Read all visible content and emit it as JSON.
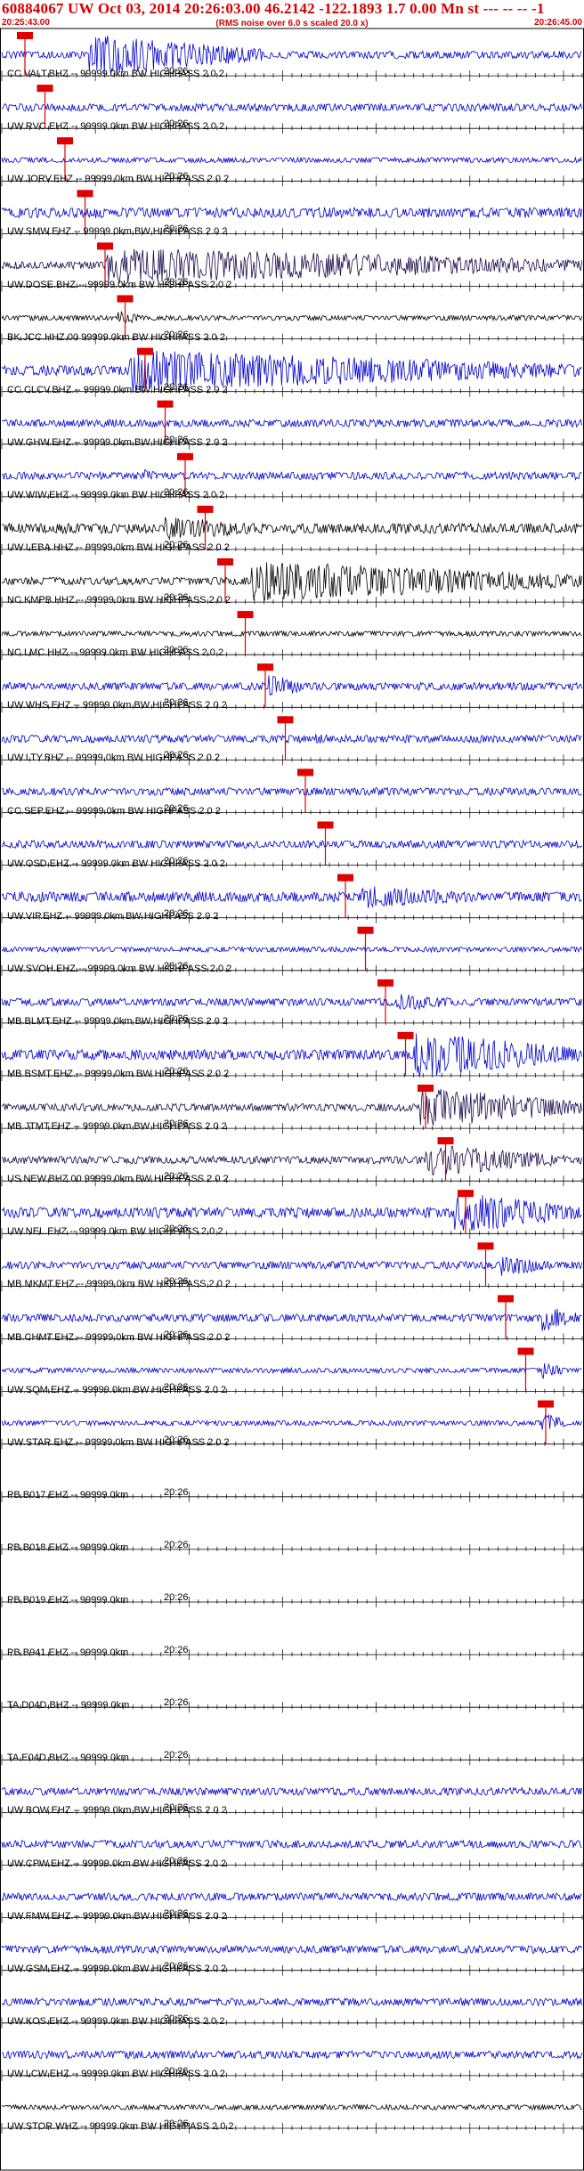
{
  "header": {
    "title": "60884067 UW Oct 03, 2014 20:26:03.00   46.2142 -122.1893  1.7 0.00 Mn st --- -- --   -1",
    "start_time": "20:25:43.00",
    "end_time": "20:26:45.00",
    "note": "(RMS noise over 6.0 s scaled 20.0 x)"
  },
  "colors": {
    "header": "#d40000",
    "trace_blue": "#0000cc",
    "trace_black": "#000000",
    "trace_navy": "#1a0a4a",
    "pick": "#e00000"
  },
  "minute_tick_label": "20:26",
  "traces": [
    {
      "label": "CC.VALT.BHZ.-- 99999.0km BW  HIGHPASS  2.0  2",
      "color": "blue",
      "amp": 3,
      "pick": 0,
      "burst": [
        0.15,
        0.45,
        18
      ]
    },
    {
      "label": "UW.RVC.EHZ.-- 99999.0km BW  HIGHPASS  2.0  2",
      "color": "blue",
      "amp": 3,
      "pick": 0,
      "burst": null
    },
    {
      "label": "UW.JORV.EHZ.-- 99999.0km BW  HIGHPASS  2.0  2",
      "color": "blue",
      "amp": 2,
      "pick": 0,
      "burst": null
    },
    {
      "label": "UW.SMW.EHZ.-- 99999.0km BW  HIGHPASS  2.0  2",
      "color": "blue",
      "amp": 4,
      "pick": 0,
      "burst": [
        0.16,
        0.2,
        6
      ]
    },
    {
      "label": "UW.DOSE.BHZ.-- 99999.0km BW  HIGHPASS  2.0  2",
      "color": "navy",
      "amp": 3,
      "pick": 0,
      "burst": [
        0.18,
        1.0,
        16
      ]
    },
    {
      "label": "BK.JCC.HHZ.00 99999.0km BW  HIGHPASS  2.0  2",
      "color": "black",
      "amp": 2,
      "pick": 0,
      "burst": [
        0.2,
        0.25,
        6
      ]
    },
    {
      "label": "CC.CLCV.BHZ.-- 99999.0km BW  HIGHPASS  2.0  2",
      "color": "blue",
      "amp": 4,
      "pick": 0,
      "burst": [
        0.22,
        1.0,
        18
      ]
    },
    {
      "label": "UW.GHW.EHZ.-- 99999.0km BW  HIGHPASS  2.0  2",
      "color": "blue",
      "amp": 3,
      "pick": 0,
      "burst": null
    },
    {
      "label": "UW.WIW.EHZ.-- 99999.0km BW  HIGHPASS  2.0  2",
      "color": "blue",
      "amp": 3,
      "pick": 0,
      "burst": [
        0.24,
        0.28,
        6
      ]
    },
    {
      "label": "UW.LEBA.HHZ.-- 99999.0km BW  HIGHPASS  2.0  2",
      "color": "black",
      "amp": 4,
      "pick": 0,
      "burst": [
        0.28,
        0.5,
        10
      ]
    },
    {
      "label": "NC.KMPB.HHZ.-- 99999.0km BW  HIGHPASS  2.0  2",
      "color": "black",
      "amp": 3,
      "pick": 0,
      "burst": [
        0.43,
        1.0,
        18
      ]
    },
    {
      "label": "NC.LMC.HHZ.-- 99999.0km BW  HIGHPASS  2.0  2",
      "color": "black",
      "amp": 2,
      "pick": 0,
      "burst": null
    },
    {
      "label": "UW.WHS.EHZ.-- 99999.0km BW  HIGHPASS  2.0  2",
      "color": "blue",
      "amp": 3,
      "pick": 0,
      "burst": [
        0.46,
        0.52,
        12
      ]
    },
    {
      "label": "UW.LTY.BHZ.-- 99999.0km BW  HIGHPASS  2.0  2",
      "color": "blue",
      "amp": 3,
      "pick": 0,
      "burst": [
        0.54,
        0.58,
        6
      ]
    },
    {
      "label": "CC.SEP.EHZ.-- 99999.0km BW  HIGHPASS  2.0  2",
      "color": "blue",
      "amp": 3,
      "pick": 0,
      "burst": null
    },
    {
      "label": "UW.OSD.EHZ.-- 99999.0km BW  HIGHPASS  2.0  2",
      "color": "blue",
      "amp": 3,
      "pick": 0,
      "burst": null
    },
    {
      "label": "UW.VIP.EHZ.-- 99999.0km BW  HIGHPASS  2.0  2",
      "color": "blue",
      "amp": 4,
      "pick": 0,
      "burst": [
        0.62,
        0.85,
        10
      ]
    },
    {
      "label": "UW.SVOH.EHZ.-- 99999.0km BW  HIGHPASS  2.0  2",
      "color": "blue",
      "amp": 2,
      "pick": 0,
      "burst": null
    },
    {
      "label": "MB.BLMT.EHZ.-- 99999.0km BW  HIGHPASS  2.0  2",
      "color": "blue",
      "amp": 3,
      "pick": 0,
      "burst": [
        0.68,
        0.8,
        8
      ]
    },
    {
      "label": "MB.BSMT.EHZ.-- 99999.0km BW  HIGHPASS  2.0  2",
      "color": "blue",
      "amp": 4,
      "pick": 0,
      "burst": [
        0.71,
        1.0,
        20
      ]
    },
    {
      "label": "MB.JTMT.EHZ.-- 99999.0km BW  HIGHPASS  2.0  2",
      "color": "navy",
      "amp": 3,
      "pick": 0,
      "burst": [
        0.72,
        1.0,
        18
      ]
    },
    {
      "label": "US.NEW.BHZ.00 99999.0km BW  HIGHPASS  2.0  2",
      "color": "navy",
      "amp": 3,
      "pick": 0,
      "burst": [
        0.73,
        0.98,
        14
      ]
    },
    {
      "label": "UW.NEL.EHZ.-- 99999.0km BW  HIGHPASS  2.0  2",
      "color": "blue",
      "amp": 4,
      "pick": 0,
      "burst": [
        0.78,
        1.0,
        18
      ]
    },
    {
      "label": "MB.MKMT.EHZ.-- 99999.0km BW  HIGHPASS  2.0  2",
      "color": "blue",
      "amp": 3,
      "pick": 0,
      "burst": [
        0.86,
        0.95,
        10
      ]
    },
    {
      "label": "MB.CHMT.EHZ.-- 99999.0km BW  HIGHPASS  2.0  2",
      "color": "blue",
      "amp": 3,
      "pick": 0,
      "burst": [
        0.93,
        1.0,
        12
      ]
    },
    {
      "label": "UW.SQM.EHZ.-- 99999.0km BW  HIGHPASS  2.0  2",
      "color": "blue",
      "amp": 2,
      "pick": 0,
      "burst": [
        0.93,
        0.97,
        8
      ]
    },
    {
      "label": "UW.STAR.EHZ.-- 99999.0km BW  HIGHPASS  2.0  2",
      "color": "blue",
      "amp": 2,
      "pick": 0,
      "burst": [
        0.93,
        0.97,
        10
      ]
    },
    {
      "label": "PB.B017.EHZ.-- 99999.0km",
      "color": "none",
      "amp": 0,
      "pick": -1,
      "burst": null
    },
    {
      "label": "PB.B018.EHZ.-- 99999.0km",
      "color": "none",
      "amp": 0,
      "pick": -1,
      "burst": null
    },
    {
      "label": "PB.B019.EHZ.-- 99999.0km",
      "color": "none",
      "amp": 0,
      "pick": -1,
      "burst": null
    },
    {
      "label": "PB.B941.EHZ.-- 99999.0km",
      "color": "none",
      "amp": 0,
      "pick": -1,
      "burst": null
    },
    {
      "label": "TA.D04D.BHZ.-- 99999.0km",
      "color": "none",
      "amp": 0,
      "pick": -1,
      "burst": null
    },
    {
      "label": "TA.E04D.BHZ.-- 99999.0km",
      "color": "none",
      "amp": 0,
      "pick": -1,
      "burst": null
    },
    {
      "label": "UW.BOW.EHZ.-- 99999.0km BW  HIGHPASS  2.0  2",
      "color": "blue",
      "amp": 3,
      "pick": -1,
      "burst": null
    },
    {
      "label": "UW.CPW.EHZ.-- 99999.0km BW  HIGHPASS  2.0  2",
      "color": "blue",
      "amp": 3,
      "pick": -1,
      "burst": null
    },
    {
      "label": "UW.FMW.EHZ.-- 99999.0km BW  HIGHPASS  2.0  2",
      "color": "blue",
      "amp": 3,
      "pick": -1,
      "burst": null
    },
    {
      "label": "UW.GSM.EHZ.-- 99999.0km BW  HIGHPASS  2.0  2",
      "color": "blue",
      "amp": 3,
      "pick": -1,
      "burst": null
    },
    {
      "label": "UW.KOS.EHZ.-- 99999.0km BW  HIGHPASS  2.0  2",
      "color": "blue",
      "amp": 3,
      "pick": -1,
      "burst": null
    },
    {
      "label": "UW.LCW.EHZ.-- 99999.0km BW  HIGHPASS  2.0  2",
      "color": "blue",
      "amp": 3,
      "pick": -1,
      "burst": null
    },
    {
      "label": "UW.STOR.WHZ.-- 99999.0km BW  HIGHPASS  2.0  2",
      "color": "black",
      "amp": 2,
      "pick": -1,
      "burst": null
    }
  ]
}
